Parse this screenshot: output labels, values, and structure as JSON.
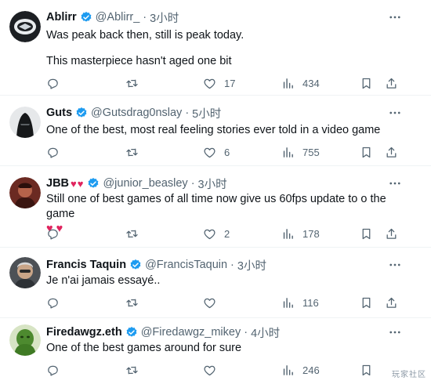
{
  "colors": {
    "accent": "#1d9bf0",
    "text": "#0f1419",
    "muted": "#536471",
    "heart": "#e0245e"
  },
  "tweets": [
    {
      "name": "Ablirr",
      "handle": "@Ablirr_",
      "time": "3小时",
      "lines": [
        "Was peak back then, still is peak today.",
        "",
        "This masterpiece hasn't aged one bit"
      ],
      "likes": "17",
      "views": "434"
    },
    {
      "name": "Guts",
      "handle": "@Gutsdrag0nslay",
      "time": "5小时",
      "lines": [
        "One of the best, most real feeling stories ever told in a video game"
      ],
      "likes": "6",
      "views": "755"
    },
    {
      "name": "JBB",
      "name_hearts": "♥♥",
      "handle": "@junior_beasley",
      "time": "3小时",
      "lines": [
        "Still one of best games of all time now give us  60fps update to o the game",
        "♥ ♥"
      ],
      "likes": "2",
      "views": "178"
    },
    {
      "name": "Francis Taquin",
      "handle": "@FrancisTaquin",
      "time": "3小时",
      "lines": [
        "Je n'ai jamais essayé.."
      ],
      "likes": "",
      "views": "116"
    },
    {
      "name": "Firedawgz.eth",
      "handle": "@Firedawgz_mikey",
      "time": "4小时",
      "lines": [
        "One of the best games around for sure"
      ],
      "likes": "",
      "views": "246"
    }
  ],
  "watermark": "玩家社区"
}
